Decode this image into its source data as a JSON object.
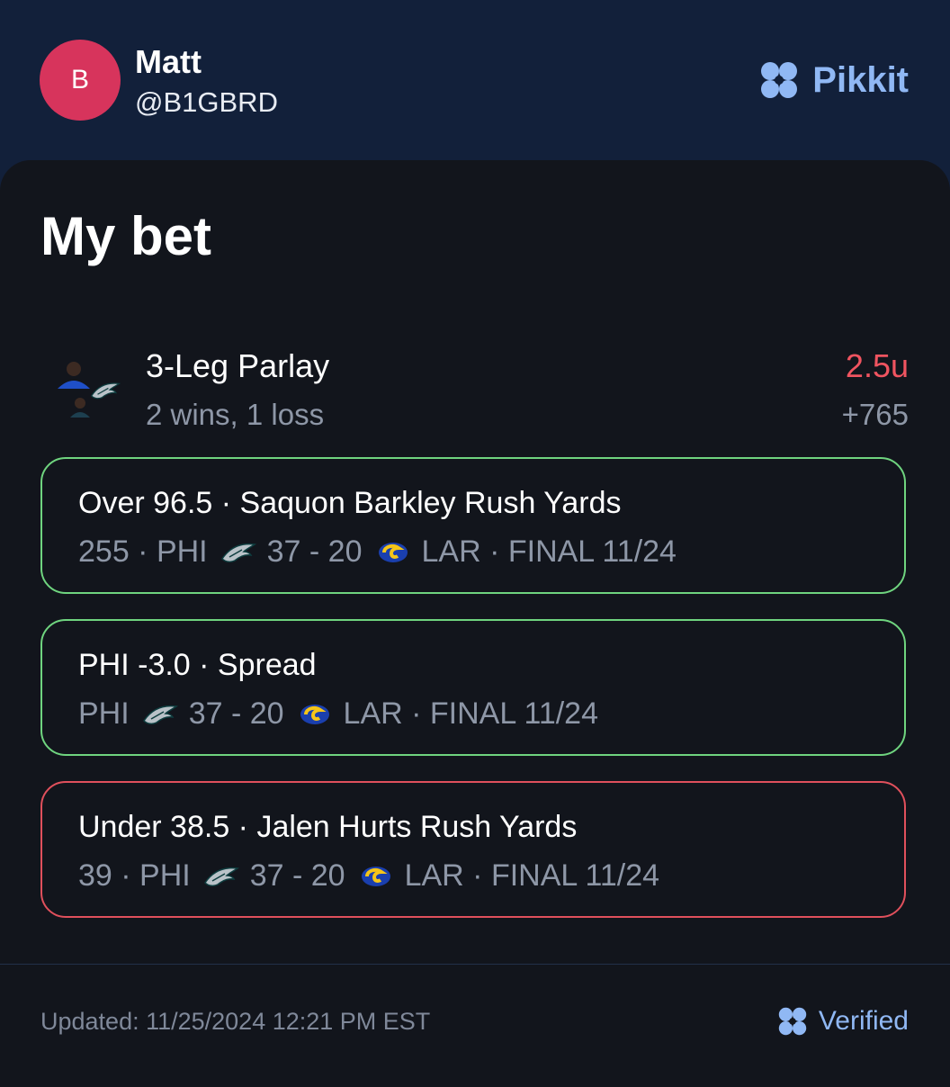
{
  "header": {
    "avatar_letter": "B",
    "name": "Matt",
    "handle": "@B1GBRD",
    "brand": "Pikkit"
  },
  "card": {
    "title": "My bet",
    "parlay": {
      "title": "3-Leg Parlay",
      "record": "2 wins, 1 loss",
      "stake": "2.5u",
      "odds": "+765"
    },
    "legs": [
      {
        "title": "Over 96.5 · Saquon Barkley Rush Yards",
        "stat": "255 · ",
        "home": "PHI",
        "score": "37 - 20",
        "away": "LAR",
        "status": " · FINAL 11/24",
        "result": "win"
      },
      {
        "title": "PHI -3.0 · Spread",
        "stat": "",
        "home": "PHI",
        "score": "37 - 20",
        "away": "LAR",
        "status": " · FINAL 11/24",
        "result": "win"
      },
      {
        "title": "Under 38.5 · Jalen Hurts Rush Yards",
        "stat": "39 · ",
        "home": "PHI",
        "score": "37 - 20",
        "away": "LAR",
        "status": " · FINAL 11/24",
        "result": "loss"
      }
    ]
  },
  "footer": {
    "updated": "Updated: 11/25/2024 12:21 PM EST",
    "verified": "Verified"
  },
  "colors": {
    "header_bg": "#12203a",
    "card_bg": "#12151c",
    "win": "#6fd47f",
    "loss": "#e0505c",
    "stake_red": "#f05460",
    "brand_blue": "#90b8f4",
    "avatar": "#d7345c"
  },
  "icons": {
    "brand": "clover-logo-icon",
    "home_team": "eagles-logo-icon",
    "away_team": "rams-logo-icon",
    "verified": "clover-verified-icon"
  }
}
